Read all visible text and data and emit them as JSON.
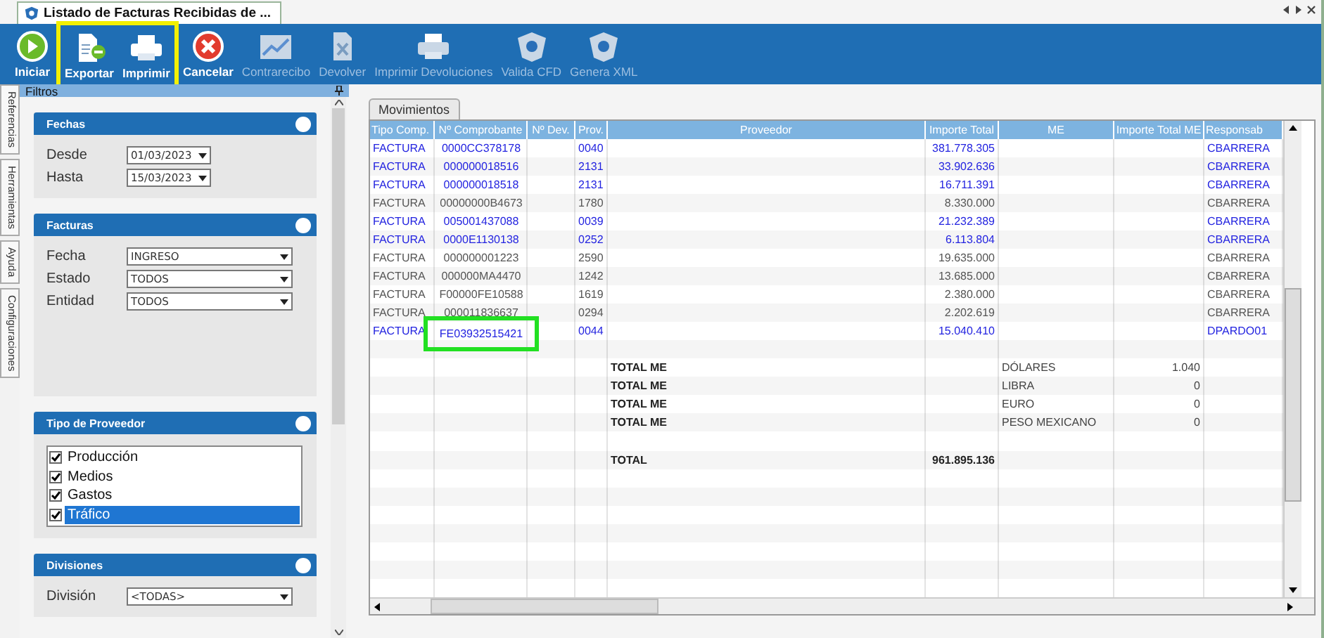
{
  "window": {
    "title": "Listado de Facturas Recibidas de ..."
  },
  "toolbar": [
    {
      "label": "Iniciar",
      "kind": "play",
      "disabled": false,
      "highlighted": false
    },
    {
      "label": "Exportar",
      "kind": "export",
      "disabled": false,
      "highlighted": true
    },
    {
      "label": "Imprimir",
      "kind": "print",
      "disabled": false,
      "highlighted": true
    },
    {
      "label": "Cancelar",
      "kind": "cancel",
      "disabled": false,
      "highlighted": false
    },
    {
      "label": "Contrarecibo",
      "kind": "chart",
      "disabled": true,
      "highlighted": false
    },
    {
      "label": "Devolver",
      "kind": "return",
      "disabled": true,
      "highlighted": false
    },
    {
      "label": "Imprimir Devoluciones",
      "kind": "print",
      "disabled": true,
      "highlighted": false
    },
    {
      "label": "Valida CFD",
      "kind": "shield",
      "disabled": true,
      "highlighted": false
    },
    {
      "label": "Genera XML",
      "kind": "shield",
      "disabled": true,
      "highlighted": false
    }
  ],
  "side_tabs": [
    "Referencias",
    "Herramientas",
    "Ayuda",
    "Configuraciones"
  ],
  "filters": {
    "title": "Filtros",
    "sections": [
      {
        "title": "Fechas",
        "kind": "fields",
        "fields": [
          {
            "label": "Desde",
            "kind": "date",
            "value": "01/03/2023"
          },
          {
            "label": "Hasta",
            "kind": "date",
            "value": "15/03/2023"
          }
        ]
      },
      {
        "title": "Facturas",
        "kind": "fields",
        "fields": [
          {
            "label": "Fecha",
            "kind": "select",
            "value": "INGRESO"
          },
          {
            "label": "Estado",
            "kind": "select",
            "value": "TODOS"
          },
          {
            "label": "Entidad",
            "kind": "select",
            "value": "TODOS"
          }
        ]
      },
      {
        "title": "Tipo de Proveedor",
        "kind": "checklist",
        "options": [
          {
            "label": "Producción",
            "checked": true,
            "selected": false
          },
          {
            "label": "Medios",
            "checked": true,
            "selected": false
          },
          {
            "label": "Gastos",
            "checked": true,
            "selected": false
          },
          {
            "label": "Tráfico",
            "checked": true,
            "selected": true
          }
        ]
      },
      {
        "title": "Divisiones",
        "kind": "fields",
        "fields": [
          {
            "label": "División",
            "kind": "select",
            "value": "<TODAS>"
          }
        ]
      }
    ]
  },
  "tab": {
    "label": "Movimientos",
    "selected": true
  },
  "table": {
    "columns": [
      "Tipo Comp.",
      "Nº Comprobante",
      "Nº Dev.",
      "Prov.",
      "Proveedor",
      "Importe Total",
      "ME",
      "Importe Total ME",
      "Responsab"
    ],
    "rows": [
      {
        "kind": "data",
        "color": "#2323e0",
        "highlighted": false,
        "tipo": "FACTURA",
        "comprobante": "0000CC378178",
        "prov": "0040",
        "importe": "381.778.305",
        "responsable": "CBARRERA"
      },
      {
        "kind": "data",
        "color": "#2323e0",
        "highlighted": false,
        "tipo": "FACTURA",
        "comprobante": "000000018516",
        "prov": "2131",
        "importe": "33.902.636",
        "responsable": "CBARRERA"
      },
      {
        "kind": "data",
        "color": "#2323e0",
        "highlighted": false,
        "tipo": "FACTURA",
        "comprobante": "000000018518",
        "prov": "2131",
        "importe": "16.711.391",
        "responsable": "CBARRERA"
      },
      {
        "kind": "data",
        "color": "#555555",
        "highlighted": false,
        "tipo": "FACTURA",
        "comprobante": "00000000B4673",
        "prov": "1780",
        "importe": "8.330.000",
        "responsable": "CBARRERA"
      },
      {
        "kind": "data",
        "color": "#2323e0",
        "highlighted": false,
        "tipo": "FACTURA",
        "comprobante": "005001437088",
        "prov": "0039",
        "importe": "21.232.389",
        "responsable": "CBARRERA"
      },
      {
        "kind": "data",
        "color": "#2323e0",
        "highlighted": false,
        "tipo": "FACTURA",
        "comprobante": "0000E1130138",
        "prov": "0252",
        "importe": "6.113.804",
        "responsable": "CBARRERA"
      },
      {
        "kind": "data",
        "color": "#555555",
        "highlighted": false,
        "tipo": "FACTURA",
        "comprobante": "000000001223",
        "prov": "2590",
        "importe": "19.635.000",
        "responsable": "CBARRERA"
      },
      {
        "kind": "data",
        "color": "#555555",
        "highlighted": false,
        "tipo": "FACTURA",
        "comprobante": "000000MA4470",
        "prov": "1242",
        "importe": "13.685.000",
        "responsable": "CBARRERA"
      },
      {
        "kind": "data",
        "color": "#555555",
        "highlighted": false,
        "tipo": "FACTURA",
        "comprobante": "F00000FE10588",
        "prov": "1619",
        "importe": "2.380.000",
        "responsable": "CBARRERA"
      },
      {
        "kind": "data",
        "color": "#555555",
        "highlighted": false,
        "tipo": "FACTURA",
        "comprobante": "000011836637",
        "prov": "0294",
        "importe": "2.202.619",
        "responsable": "CBARRERA"
      },
      {
        "kind": "data",
        "color": "#2323e0",
        "highlighted": true,
        "tipo": "FACTURA",
        "comprobante": "FE03932515421",
        "prov": "0044",
        "importe": "15.040.410",
        "responsable": "DPARDO01"
      },
      {
        "kind": "spacer"
      },
      {
        "kind": "total",
        "label": "TOTAL ME",
        "currency": "DÓLARES",
        "amount_me": "1.040"
      },
      {
        "kind": "total",
        "label": "TOTAL ME",
        "currency": "LIBRA",
        "amount_me": "0"
      },
      {
        "kind": "total",
        "label": "TOTAL ME",
        "currency": "EURO",
        "amount_me": "0"
      },
      {
        "kind": "total",
        "label": "TOTAL ME",
        "currency": "PESO MEXICANO",
        "amount_me": "0"
      },
      {
        "kind": "spacer"
      },
      {
        "kind": "total",
        "label": "TOTAL",
        "amount": "961.895.136"
      }
    ]
  }
}
